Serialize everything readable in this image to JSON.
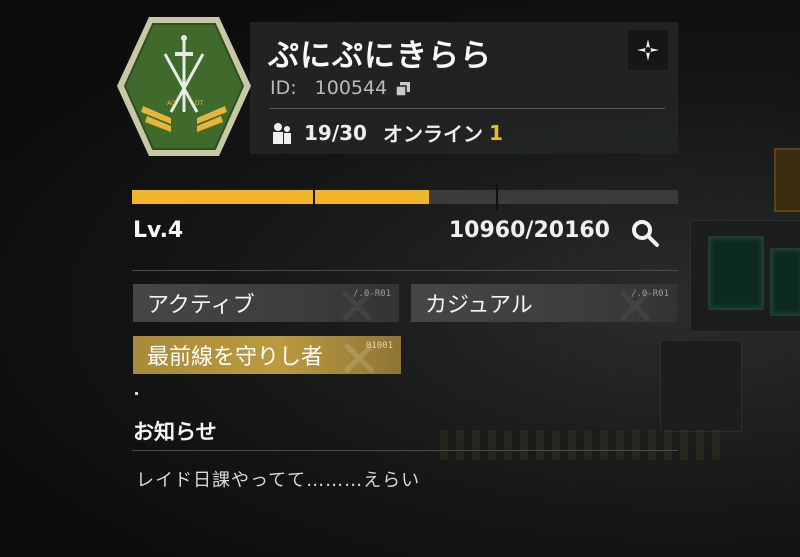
{
  "profile": {
    "name": "ぷにぷにきらら",
    "id_label": "ID:",
    "id_value": "100544",
    "members": "19/30",
    "online_label": "オンライン",
    "online_count": "1",
    "badge_text": "AO ... DT"
  },
  "level": {
    "label": "Lv.4",
    "xp_text": "10960/20160",
    "progress_fraction": 0.544
  },
  "tags": [
    {
      "label": "アクティブ",
      "code": "/.0-R01"
    },
    {
      "label": "カジュアル",
      "code": "/.0-R01"
    },
    {
      "label": "最前線を守りし者",
      "code": "01001"
    }
  ],
  "notice": {
    "title": "お知らせ",
    "text": "レイド日課やってて………えらい"
  },
  "colors": {
    "accent": "#f0b52a",
    "badge_green": "#3f6a2b",
    "panel": "#232525"
  },
  "icons": {
    "settings": "settings-icon",
    "copy": "copy-icon",
    "members": "members-icon",
    "search": "search-icon"
  }
}
